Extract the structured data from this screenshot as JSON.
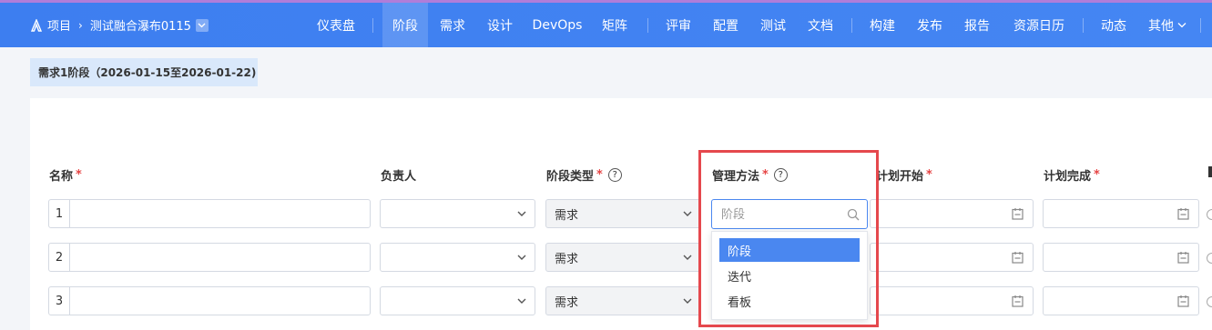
{
  "breadcrumb": {
    "root": "项目",
    "project": "测试融合瀑布0115"
  },
  "nav": [
    {
      "label": "仪表盘"
    },
    {
      "label": "阶段"
    },
    {
      "label": "需求"
    },
    {
      "label": "设计"
    },
    {
      "label": "DevOps"
    },
    {
      "label": "矩阵"
    },
    {
      "label": "评审"
    },
    {
      "label": "配置"
    },
    {
      "label": "测试"
    },
    {
      "label": "文档"
    },
    {
      "label": "构建"
    },
    {
      "label": "发布"
    },
    {
      "label": "报告"
    },
    {
      "label": "资源日历"
    },
    {
      "label": "动态"
    },
    {
      "label": "其他"
    }
  ],
  "nav_active": "阶段",
  "stage_title": "需求1阶段（2026-01-15至2026-01-22)",
  "columns": {
    "name": "名称",
    "owner": "负责人",
    "stage_type": "阶段类型",
    "method": "管理方法",
    "plan_start": "计划开始",
    "plan_end": "计划完成",
    "required_mark": "*",
    "help_mark": "?"
  },
  "rows": [
    {
      "index": "1",
      "stage_type": "需求"
    },
    {
      "index": "2",
      "stage_type": "需求"
    },
    {
      "index": "3",
      "stage_type": "需求"
    }
  ],
  "method_search": {
    "placeholder": "阶段"
  },
  "method_options": [
    "阶段",
    "迭代",
    "看板"
  ],
  "colors": {
    "topbar": "#4586f3",
    "accent": "#4a87f0",
    "highlight_frame": "#e5484d",
    "required": "#e64545"
  }
}
